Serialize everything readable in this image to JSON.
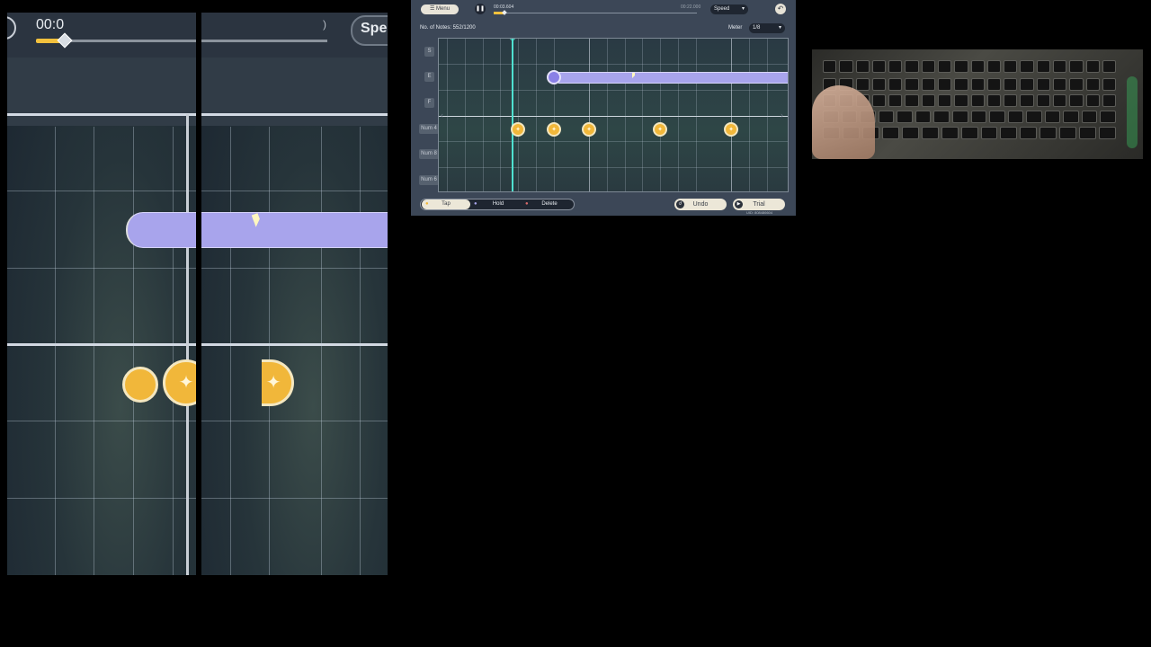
{
  "zoom_view": {
    "time_text": "00:0",
    "speed_text": "Spe"
  },
  "editor": {
    "menu_label": "Menu",
    "current_time": "00:03.604",
    "total_time": "00:22.000",
    "speed_label": "Speed",
    "notes_count_label": "No. of Notes: 552/1200",
    "meter_label": "Meter",
    "meter_value": "1/8",
    "lanes": [
      "S",
      "E",
      "F",
      "Num 4",
      "Num 8",
      "Num 6"
    ],
    "tools": [
      {
        "label": "Tap"
      },
      {
        "label": "Hold"
      },
      {
        "label": "Delete"
      }
    ],
    "undo_label": "Undo",
    "trial_label": "Trial",
    "uid_text": "UID: 808486604"
  },
  "playback_progress": 0.05,
  "colors": {
    "hold_note": "#a8a4ec",
    "tap_note": "#f1b73a",
    "playhead": "#4fe0d0",
    "editor_bg": "#3c4757"
  },
  "icons": [
    "pause-icon",
    "menu-icon",
    "back-icon",
    "dropdown-icon",
    "star-icon",
    "undo-icon",
    "play-icon"
  ]
}
